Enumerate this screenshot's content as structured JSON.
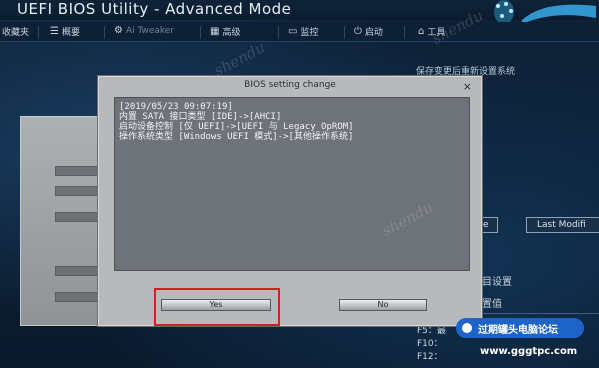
{
  "window": {
    "title": "UEFI BIOS Utility - Advanced Mode"
  },
  "menubar": {
    "items": [
      {
        "label": "收藏夹",
        "icon": "star-icon"
      },
      {
        "label": "概要",
        "icon": "grid-icon"
      },
      {
        "label": "Ai Tweaker",
        "icon": "tweak-icon"
      },
      {
        "label": "高级",
        "icon": "advanced-icon"
      },
      {
        "label": "监控",
        "icon": "monitor-icon"
      },
      {
        "label": "启动",
        "icon": "power-icon"
      },
      {
        "label": "工具",
        "icon": "tool-icon"
      }
    ]
  },
  "right_panel": {
    "save_hint": "保存变更后重新设置系统",
    "e_btn": "e",
    "last_modified": "Last Modifi",
    "line1": "目设置",
    "line2": "置值",
    "fkeys": [
      "F5：最",
      "F10：",
      "F12："
    ]
  },
  "dialog": {
    "title": "BIOS setting change",
    "close": "×",
    "log": [
      "[2019/05/23 09:07:19]",
      "内置 SATA 接口类型 [IDE]->[AHCI]",
      "启动设备控制 [仅 UEFI]->[UEFI 与 Legacy OpROM]",
      "操作系统类型 [Windows UEFI 模式]->[其他操作系统]"
    ],
    "yes_label": "Yes",
    "no_label": "No"
  },
  "watermark": {
    "text": "shendu"
  },
  "site": {
    "banner": "过期罐头电脑论坛",
    "url": "www.gggtpc.com"
  },
  "colors": {
    "highlight": "#d31f1f",
    "banner": "#1e64c8"
  }
}
